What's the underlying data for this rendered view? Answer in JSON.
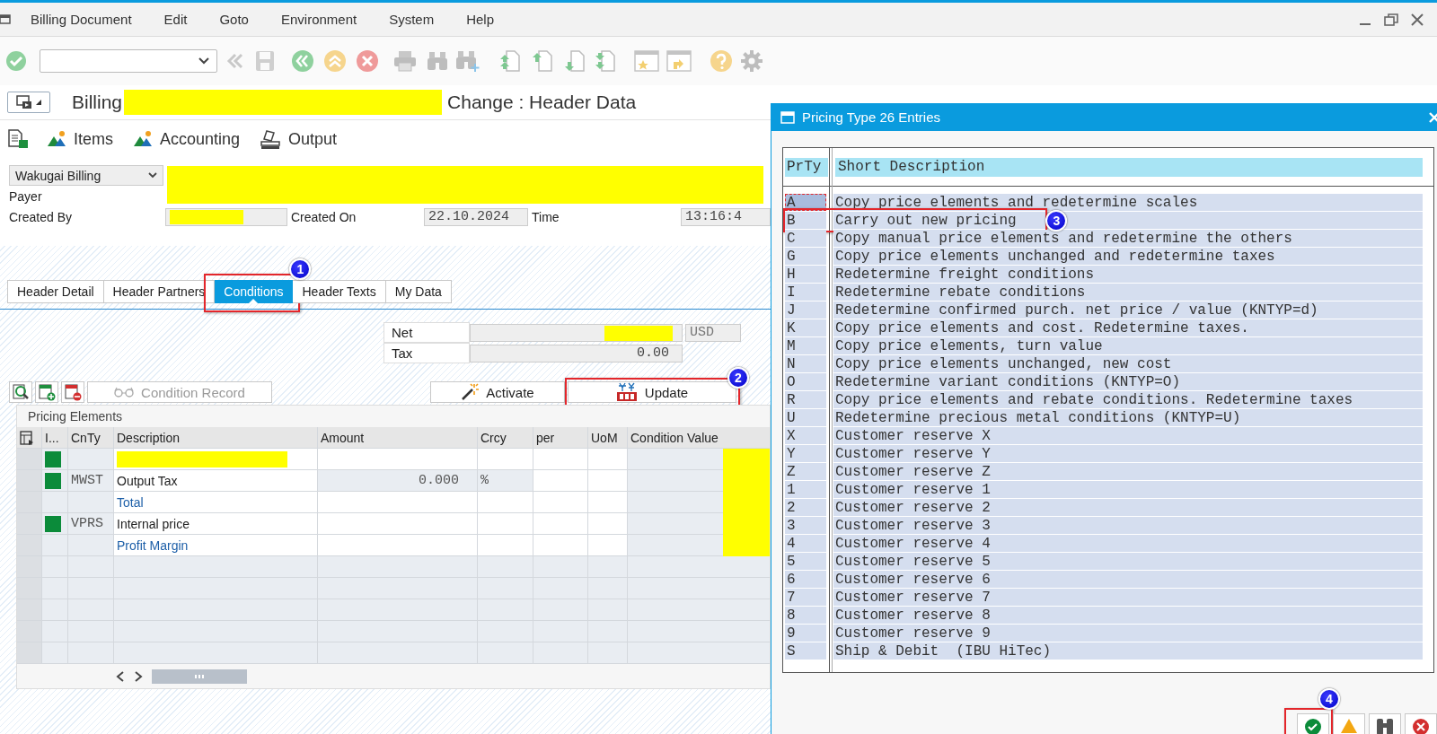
{
  "menu": [
    "Billing Document",
    "Edit",
    "Goto",
    "Environment",
    "System",
    "Help"
  ],
  "title": {
    "prefix": "Billing",
    "suffix": "Change : Header Data"
  },
  "actions": [
    {
      "kind": "document"
    },
    {
      "kind": "scene",
      "label": "Items"
    },
    {
      "kind": "scene",
      "label": "Accounting"
    },
    {
      "kind": "output",
      "label": "Output"
    }
  ],
  "header": {
    "dropdown": "Wakugai Billing",
    "payer_label": "Payer",
    "created_by_label": "Created By",
    "created_on_label": "Created On",
    "created_on": "22.10.2024",
    "time_label": "Time",
    "time": "13:16:4"
  },
  "tabs": [
    {
      "label": "Header Detail",
      "selected": false
    },
    {
      "label": "Header Partners",
      "selected": false
    },
    {
      "label": "Conditions",
      "selected": true,
      "callout": "1"
    },
    {
      "label": "Header Texts",
      "selected": false
    },
    {
      "label": "My Data",
      "selected": false
    }
  ],
  "totals": {
    "net_label": "Net",
    "currency": "USD",
    "tax_label": "Tax",
    "tax": "0.00"
  },
  "condition_toolbar": {
    "record": {
      "label": "Condition Record",
      "disabled": true
    },
    "activate": {
      "label": "Activate"
    },
    "update": {
      "label": "Update",
      "callout": "2"
    }
  },
  "pricing": {
    "title": "Pricing Elements",
    "columns": [
      "I...",
      "CnTy",
      "Description",
      "Amount",
      "Crcy",
      "per",
      "UoM",
      "Condition Value"
    ],
    "rows": [
      {
        "kind": "redacted",
        "active": true
      },
      {
        "kind": "condition",
        "active": true,
        "cnty": "MWST",
        "description": "Output Tax",
        "amount": "0.000",
        "crcy": "%"
      },
      {
        "kind": "subtotal",
        "active": false,
        "description": "Total"
      },
      {
        "kind": "condition",
        "active": true,
        "cnty": "VPRS",
        "description": "Internal price"
      },
      {
        "kind": "subtotal",
        "active": false,
        "description": "Profit Margin"
      }
    ]
  },
  "popup": {
    "title": "Pricing Type 26 Entries",
    "columns": [
      "PrTy",
      "Short Description"
    ],
    "entries": [
      {
        "code": "A",
        "text": "Copy price elements and redetermine scales",
        "focused": true
      },
      {
        "code": "B",
        "text": "Carry out new pricing",
        "focused": false,
        "callout": "3"
      },
      {
        "code": "C",
        "text": "Copy manual price elements and redetermine the others",
        "focused": false
      },
      {
        "code": "G",
        "text": "Copy price elements unchanged and redetermine taxes",
        "focused": false
      },
      {
        "code": "H",
        "text": "Redetermine freight conditions",
        "focused": false
      },
      {
        "code": "I",
        "text": "Redetermine rebate conditions",
        "focused": false
      },
      {
        "code": "J",
        "text": "Redetermine confirmed purch. net price / value (KNTYP=d)",
        "focused": false
      },
      {
        "code": "K",
        "text": "Copy price elements and cost. Redetermine taxes.",
        "focused": false
      },
      {
        "code": "M",
        "text": "Copy price elements, turn value",
        "focused": false
      },
      {
        "code": "N",
        "text": "Copy price elements unchanged, new cost",
        "focused": false
      },
      {
        "code": "O",
        "text": "Redetermine variant conditions (KNTYP=O)",
        "focused": false
      },
      {
        "code": "R",
        "text": "Copy price elements and rebate conditions. Redetermine taxes",
        "focused": false
      },
      {
        "code": "U",
        "text": "Redetermine precious metal conditions (KNTYP=U)",
        "focused": false
      },
      {
        "code": "X",
        "text": "Customer reserve X",
        "focused": false
      },
      {
        "code": "Y",
        "text": "Customer reserve Y",
        "focused": false
      },
      {
        "code": "Z",
        "text": "Customer reserve Z",
        "focused": false
      },
      {
        "code": "1",
        "text": "Customer reserve 1",
        "focused": false
      },
      {
        "code": "2",
        "text": "Customer reserve 2",
        "focused": false
      },
      {
        "code": "3",
        "text": "Customer reserve 3",
        "focused": false
      },
      {
        "code": "4",
        "text": "Customer reserve 4",
        "focused": false
      },
      {
        "code": "5",
        "text": "Customer reserve 5",
        "focused": false
      },
      {
        "code": "6",
        "text": "Customer reserve 6",
        "focused": false
      },
      {
        "code": "7",
        "text": "Customer reserve 7",
        "focused": false
      },
      {
        "code": "8",
        "text": "Customer reserve 8",
        "focused": false
      },
      {
        "code": "9",
        "text": "Customer reserve 9",
        "focused": false
      },
      {
        "code": "S",
        "text": "Ship & Debit  (IBU HiTec)",
        "focused": false
      }
    ],
    "buttons": [
      {
        "kind": "confirm",
        "callout": "4"
      },
      {
        "kind": "warning"
      },
      {
        "kind": "find"
      },
      {
        "kind": "cancel"
      }
    ]
  }
}
